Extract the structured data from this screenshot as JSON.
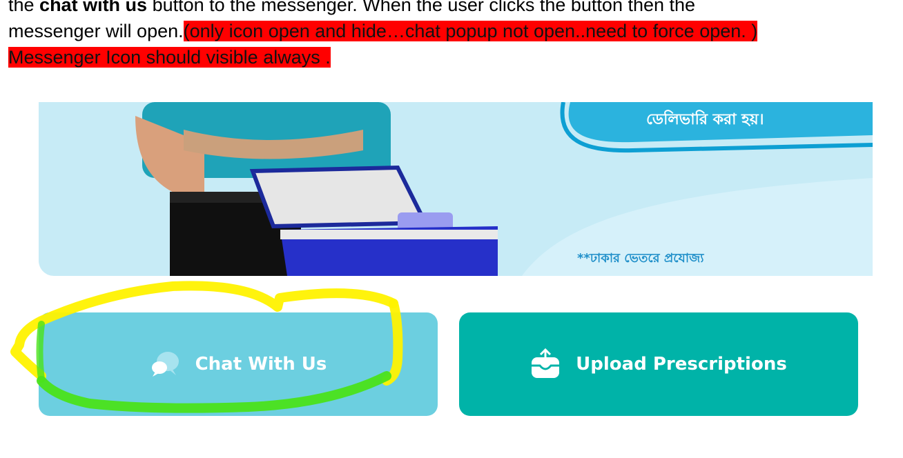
{
  "note": {
    "line1_prefix": "the ",
    "line1_bold": "chat with us",
    "line1_suffix": " button to the messenger. When the user clicks the button then the",
    "line2_text": "messenger will open.",
    "highlight_text": "(only icon open and hide…chat popup not open..need to force open. ) Messenger Icon should visible always ."
  },
  "banner": {
    "delivery_text": "ডেলিভারি করা হয়।",
    "footnote": "**ঢাকার ভেতরে প্রযোজ্য"
  },
  "buttons": {
    "chat_label": "Chat With Us",
    "upload_label": "Upload Prescriptions"
  },
  "colors": {
    "highlight": "#ff0000",
    "chat_button": "#6ccfe0",
    "upload_button": "#00b3a8",
    "banner_bg": "#c7ebf6",
    "annotation_yellow": "#fff200",
    "annotation_green": "#4be21a"
  }
}
